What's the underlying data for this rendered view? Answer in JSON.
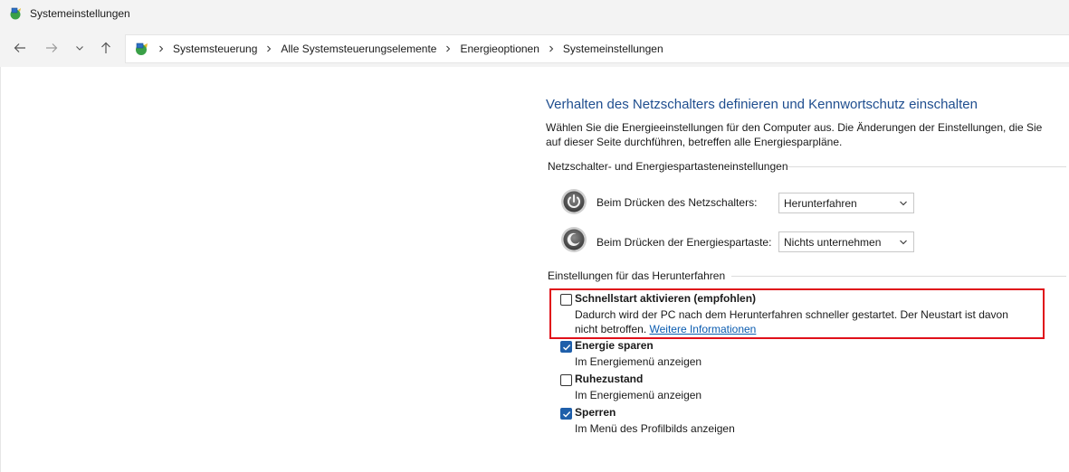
{
  "window": {
    "title": "Systemeinstellungen"
  },
  "breadcrumb": [
    "Systemsteuerung",
    "Alle Systemsteuerungselemente",
    "Energieoptionen",
    "Systemeinstellungen"
  ],
  "page": {
    "title": "Verhalten des Netzschalters definieren und Kennwortschutz einschalten",
    "description": "Wählen Sie die Energieeinstellungen für den Computer aus. Die Änderungen der Einstellungen, die Sie auf dieser Seite durchführen, betreffen alle Energiesparpläne."
  },
  "buttons_section": {
    "heading": "Netzschalter- und Energiespartasteneinstellungen",
    "power_button_label": "Beim Drücken des Netzschalters:",
    "power_button_value": "Herunterfahren",
    "sleep_button_label": "Beim Drücken der Energiespartaste:",
    "sleep_button_value": "Nichts unternehmen"
  },
  "shutdown_section": {
    "heading": "Einstellungen für das Herunterfahren",
    "options": [
      {
        "title": "Schnellstart aktivieren (empfohlen)",
        "desc": "Dadurch wird der PC nach dem Herunterfahren schneller gestartet. Der Neustart ist davon nicht betroffen.",
        "link": "Weitere Informationen",
        "checked": false
      },
      {
        "title": "Energie sparen",
        "desc": "Im Energiemenü anzeigen",
        "checked": true
      },
      {
        "title": "Ruhezustand",
        "desc": "Im Energiemenü anzeigen",
        "checked": false
      },
      {
        "title": "Sperren",
        "desc": "Im Menü des Profilbilds anzeigen",
        "checked": true
      }
    ]
  },
  "colors": {
    "accent": "#1f5faa",
    "title": "#1f4e8f",
    "highlight": "#e0101a",
    "link": "#0b5cb0"
  }
}
